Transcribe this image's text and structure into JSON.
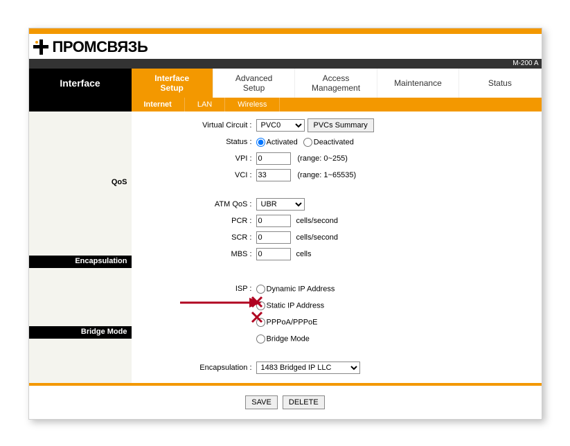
{
  "brand": "ПРОМСВЯЗЬ",
  "model": "M-200 A",
  "side_title": "Interface",
  "tabs": {
    "interface_setup": "Interface\nSetup",
    "advanced_setup": "Advanced\nSetup",
    "access_management": "Access\nManagement",
    "maintenance": "Maintenance",
    "status": "Status"
  },
  "subtabs": {
    "internet": "Internet",
    "lan": "LAN",
    "wireless": "Wireless"
  },
  "sections": {
    "qos": "QoS",
    "encapsulation": "Encapsulation",
    "bridge_mode": "Bridge Mode"
  },
  "labels": {
    "virtual_circuit": "Virtual Circuit :",
    "pvcs_summary": "PVCs Summary",
    "status": "Status :",
    "activated": "Activated",
    "deactivated": "Deactivated",
    "vpi": "VPI :",
    "vpi_range": "(range: 0~255)",
    "vci": "VCI :",
    "vci_range": "(range: 1~65535)",
    "atm_qos": "ATM QoS :",
    "pcr": "PCR :",
    "scr": "SCR :",
    "mbs": "MBS :",
    "cells_sec": "cells/second",
    "cells": "cells",
    "isp": "ISP :",
    "dyn_ip": "Dynamic IP Address",
    "static_ip": "Static IP Address",
    "pppoa": "PPPoA/PPPoE",
    "bridge": "Bridge Mode",
    "encap": "Encapsulation :"
  },
  "values": {
    "virtual_circuit": "PVC0",
    "status": "activated",
    "vpi": "0",
    "vci": "33",
    "atm_qos": "UBR",
    "pcr": "0",
    "scr": "0",
    "mbs": "0",
    "encap": "1483 Bridged IP LLC"
  },
  "buttons": {
    "save": "SAVE",
    "delete": "DELETE"
  }
}
